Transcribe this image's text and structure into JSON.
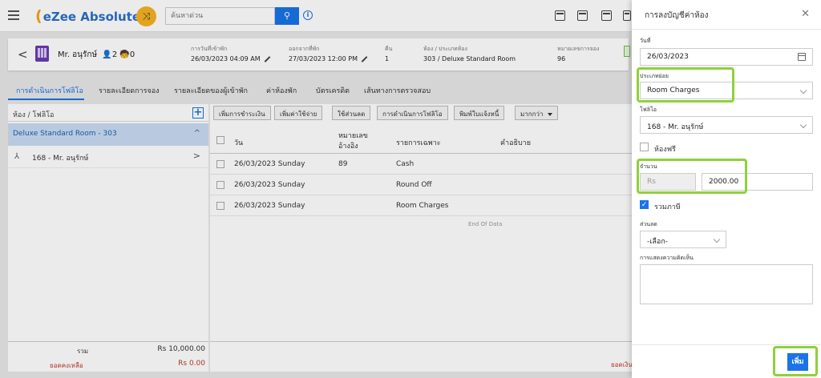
{
  "app": {
    "name": "eZee Absolute",
    "search_placeholder": "ค้นหาด่วน"
  },
  "guest": {
    "name": "Mr. อนุรักษ์",
    "adults": "2",
    "children": "0",
    "arrival_label": "การวันที่เข้าพัก",
    "arrival_value": "26/03/2023 04:09 AM",
    "departure_label": "ออกจากที่พัก",
    "departure_value": "27/03/2023 12:00 PM",
    "nights_label": "คืน",
    "nights_value": "1",
    "room_label": "ห้อง / ประเภทห้อง",
    "room_value": "303 / Deluxe Standard Room",
    "res_label": "หมายเลขการจอง",
    "res_value": "96"
  },
  "tabs": [
    "การดำเนินการโฟลิโอ",
    "รายละเอียดการจอง",
    "รายละเอียดของผู้เข้าพัก",
    "ค่าห้องพัก",
    "บัตรเครดิต",
    "เส้นทางการตรวจสอบ"
  ],
  "left": {
    "header": "ห้อง / โฟลิโอ",
    "room": "Deluxe Standard Room - 303",
    "folio": "168 - Mr. อนุรักษ์",
    "total_label": "รวม",
    "total_value": "Rs 10,000.00",
    "balance_label": "ยอดคงเหลือ",
    "balance_value": "Rs 0.00"
  },
  "toolbar": [
    "เพิ่มการชำระเงิน",
    "เพิ่มค่าใช้จ่าย",
    "ใช้ส่วนลด",
    "การดำเนินการโฟลิโอ",
    "พิมพ์ใบแจ้งหนี้",
    "มากกว่า"
  ],
  "table": {
    "headers": {
      "day": "วัน",
      "ref_1": "หมายเลข",
      "ref_2": "อ้างอิง",
      "particular": "รายการเฉพาะ",
      "desc": "คำอธิบาย"
    },
    "rows": [
      {
        "day": "26/03/2023 Sunday",
        "ref": "89",
        "particular": "Cash"
      },
      {
        "day": "26/03/2023 Sunday",
        "ref": "",
        "particular": "Round Off"
      },
      {
        "day": "26/03/2023 Sunday",
        "ref": "",
        "particular": "Room Charges"
      }
    ],
    "end_text": "End Of Data",
    "balance_label": "ยอดเงิน"
  },
  "form": {
    "title": "การลงบัญชีค่าห้อง",
    "date_label": "วันที่",
    "date_value": "26/03/2023",
    "type_label": "ประเภทย่อย",
    "type_value": "Room Charges",
    "folio_label": "โฟลิโอ",
    "folio_value": "168 - Mr. อนุรักษ์",
    "free_label": "ห้องฟรี",
    "amount_label": "จำนวน",
    "currency": "Rs",
    "amount_value": "2000.00",
    "tax_label": "รวมภาษี",
    "discount_label": "ส่วนลด",
    "discount_value": "-เลือก-",
    "comment_label": "การแสดงความคิดเห็น",
    "add_button": "เพิ่ม"
  },
  "colors": {
    "accent": "#1a73e8",
    "highlight": "#8ed13a",
    "negative": "#c0392b"
  }
}
